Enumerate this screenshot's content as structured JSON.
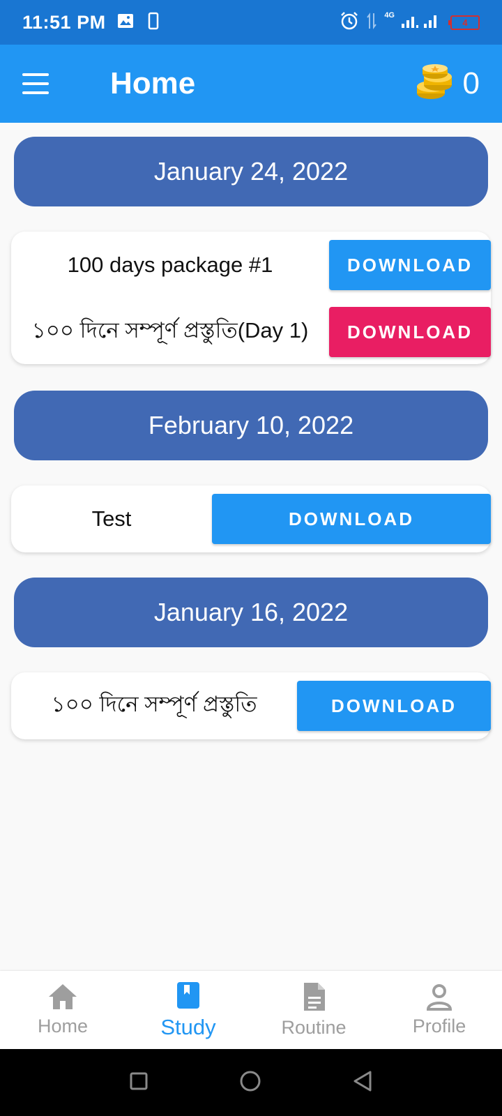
{
  "status_bar": {
    "time": "11:51 PM",
    "network": "4G",
    "battery_level": "4"
  },
  "app_bar": {
    "title": "Home",
    "coin_count": "0"
  },
  "sections": [
    {
      "date": "January 24, 2022",
      "items": [
        {
          "label": "100 days package #1",
          "button": "DOWNLOAD",
          "button_color": "#2196f3"
        },
        {
          "label": "১০০ দিনে সম্পূর্ণ প্রস্তুতি(Day 1)",
          "button": "DOWNLOAD",
          "button_color": "#e91e63"
        }
      ]
    },
    {
      "date": "February 10, 2022",
      "items": [
        {
          "label": "Test",
          "button": "DOWNLOAD",
          "button_color": "#2196f3"
        }
      ]
    },
    {
      "date": "January 16, 2022",
      "items": [
        {
          "label": "১০০ দিনে সম্পূর্ণ প্রস্তুতি",
          "button": "DOWNLOAD",
          "button_color": "#2196f3"
        }
      ]
    }
  ],
  "bottom_nav": [
    {
      "label": "Home",
      "icon": "home-icon",
      "active": false
    },
    {
      "label": "Study",
      "icon": "book-icon",
      "active": true
    },
    {
      "label": "Routine",
      "icon": "document-icon",
      "active": false
    },
    {
      "label": "Profile",
      "icon": "person-icon",
      "active": false
    }
  ],
  "colors": {
    "status_bar": "#1976d2",
    "app_bar": "#2196f3",
    "date_header": "#4169b4",
    "accent_pink": "#e91e63"
  }
}
